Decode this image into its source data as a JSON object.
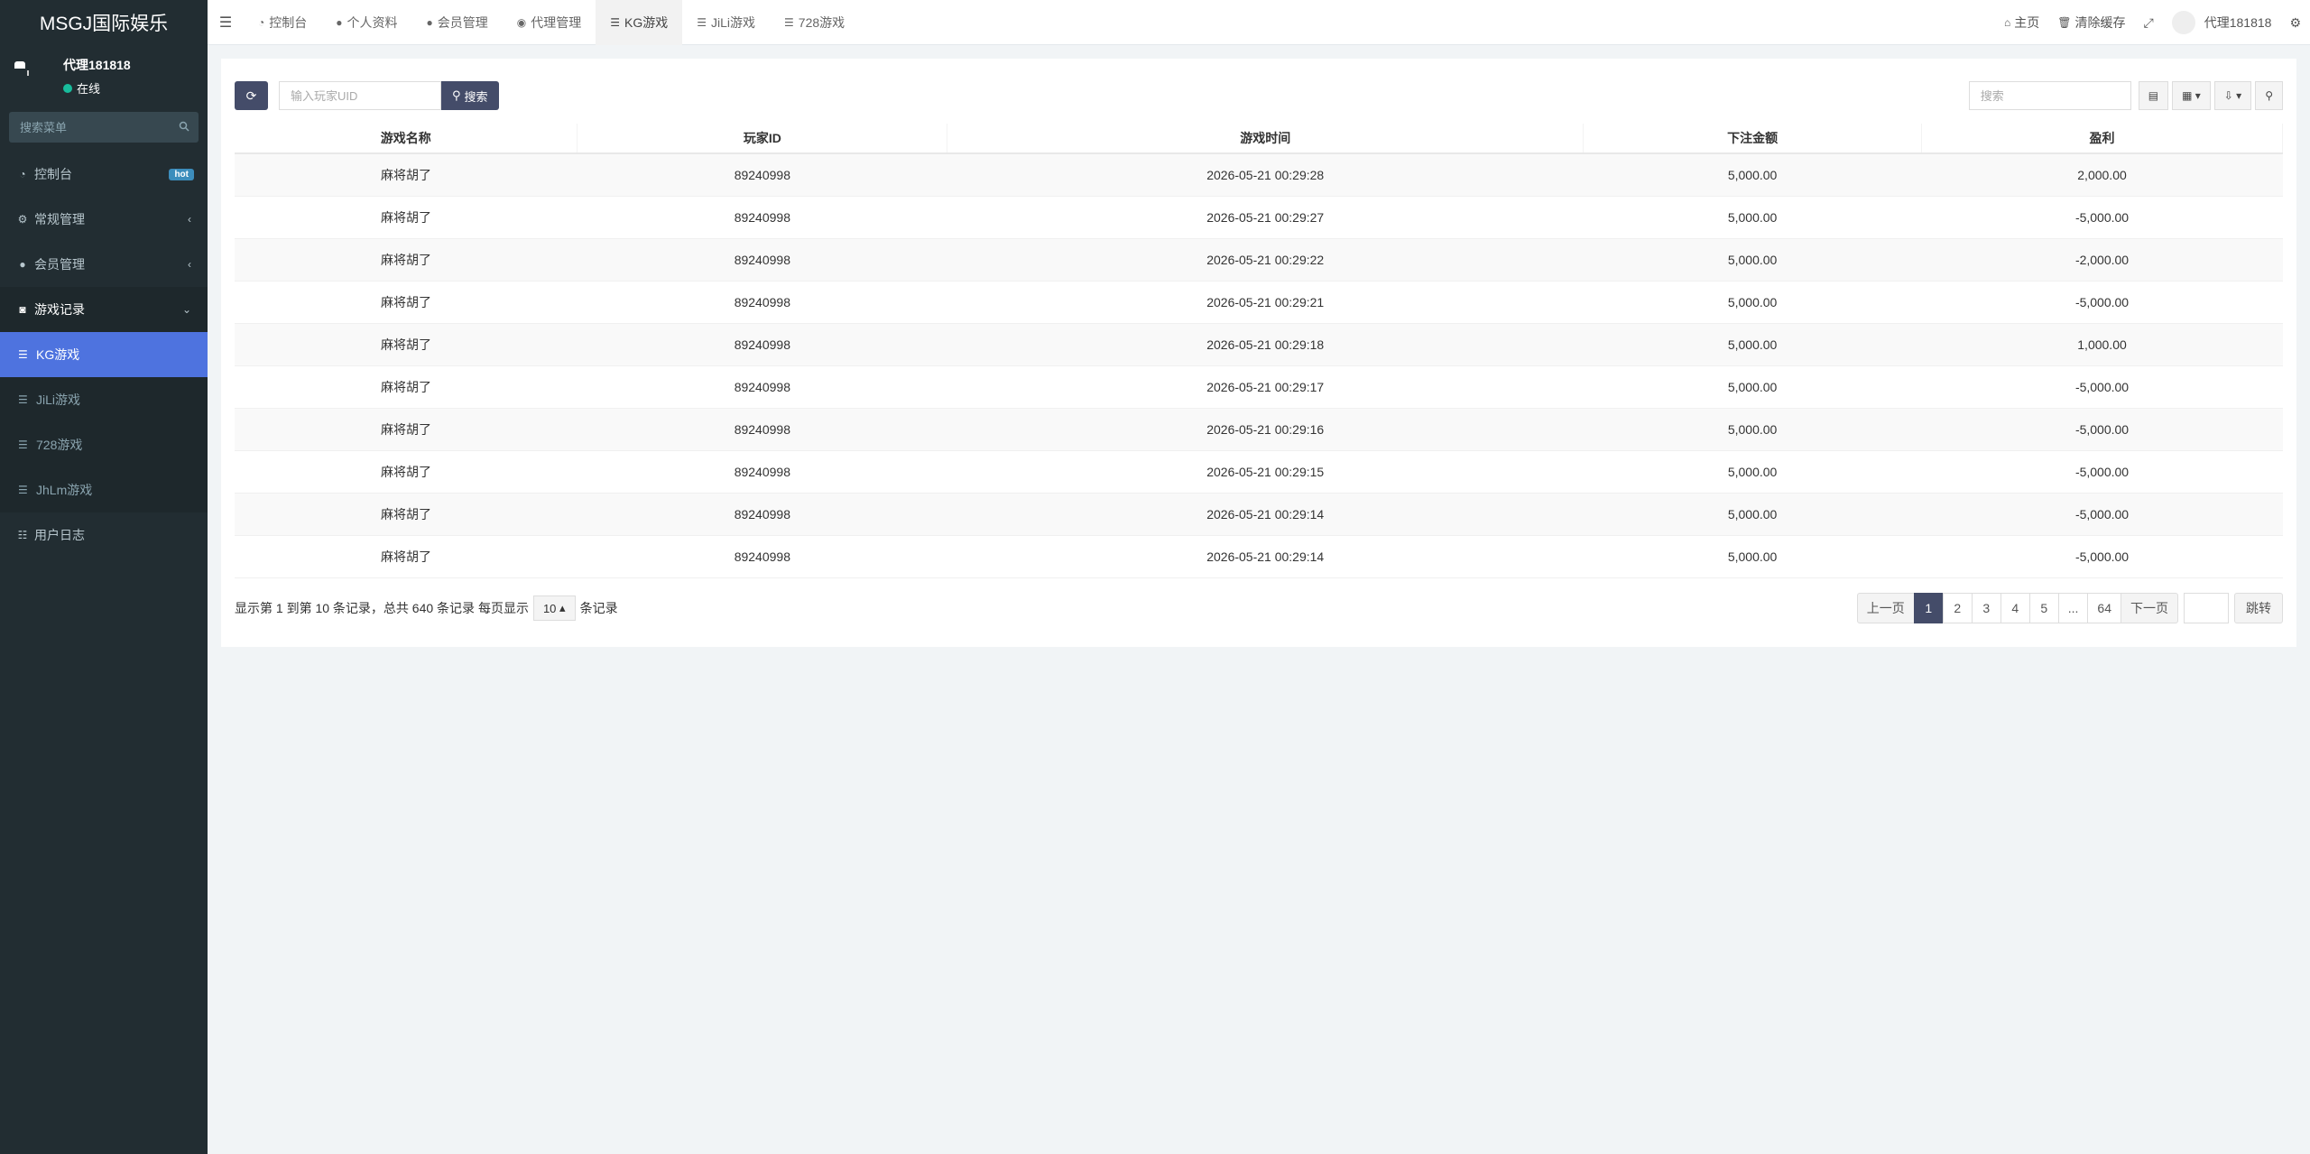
{
  "brand": "MSGJ国际娱乐",
  "user": {
    "name": "代理181818",
    "status": "在线"
  },
  "sidebar": {
    "search_placeholder": "搜索菜单",
    "items": [
      {
        "label": "控制台",
        "badge": "hot"
      },
      {
        "label": "常规管理"
      },
      {
        "label": "会员管理"
      },
      {
        "label": "游戏记录"
      },
      {
        "label": "用户日志"
      }
    ],
    "sub_items": [
      {
        "label": "KG游戏"
      },
      {
        "label": "JiLi游戏"
      },
      {
        "label": "728游戏"
      },
      {
        "label": "JhLm游戏"
      }
    ]
  },
  "header": {
    "tabs": [
      {
        "label": "控制台"
      },
      {
        "label": "个人资料"
      },
      {
        "label": "会员管理"
      },
      {
        "label": "代理管理"
      },
      {
        "label": "KG游戏"
      },
      {
        "label": "JiLi游戏"
      },
      {
        "label": "728游戏"
      }
    ],
    "home": "主页",
    "clear_cache": "清除缓存",
    "user": "代理181818"
  },
  "toolbar": {
    "uid_placeholder": "输入玩家UID",
    "search_label": "搜索",
    "search_box_placeholder": "搜索"
  },
  "table": {
    "columns": [
      "游戏名称",
      "玩家ID",
      "游戏时间",
      "下注金额",
      "盈利"
    ],
    "rows": [
      [
        "麻将胡了",
        "89240998",
        "2026-05-21 00:29:28",
        "5,000.00",
        "2,000.00"
      ],
      [
        "麻将胡了",
        "89240998",
        "2026-05-21 00:29:27",
        "5,000.00",
        "-5,000.00"
      ],
      [
        "麻将胡了",
        "89240998",
        "2026-05-21 00:29:22",
        "5,000.00",
        "-2,000.00"
      ],
      [
        "麻将胡了",
        "89240998",
        "2026-05-21 00:29:21",
        "5,000.00",
        "-5,000.00"
      ],
      [
        "麻将胡了",
        "89240998",
        "2026-05-21 00:29:18",
        "5,000.00",
        "1,000.00"
      ],
      [
        "麻将胡了",
        "89240998",
        "2026-05-21 00:29:17",
        "5,000.00",
        "-5,000.00"
      ],
      [
        "麻将胡了",
        "89240998",
        "2026-05-21 00:29:16",
        "5,000.00",
        "-5,000.00"
      ],
      [
        "麻将胡了",
        "89240998",
        "2026-05-21 00:29:15",
        "5,000.00",
        "-5,000.00"
      ],
      [
        "麻将胡了",
        "89240998",
        "2026-05-21 00:29:14",
        "5,000.00",
        "-5,000.00"
      ],
      [
        "麻将胡了",
        "89240998",
        "2026-05-21 00:29:14",
        "5,000.00",
        "-5,000.00"
      ]
    ]
  },
  "footer": {
    "info_prefix": "显示第 1 到第 10 条记录，总共 640 条记录 每页显示",
    "page_size": "10",
    "info_suffix": "条记录"
  },
  "pagination": {
    "prev": "上一页",
    "pages": [
      "1",
      "2",
      "3",
      "4",
      "5",
      "...",
      "64"
    ],
    "active": "1",
    "next": "下一页",
    "jump": "跳转"
  }
}
